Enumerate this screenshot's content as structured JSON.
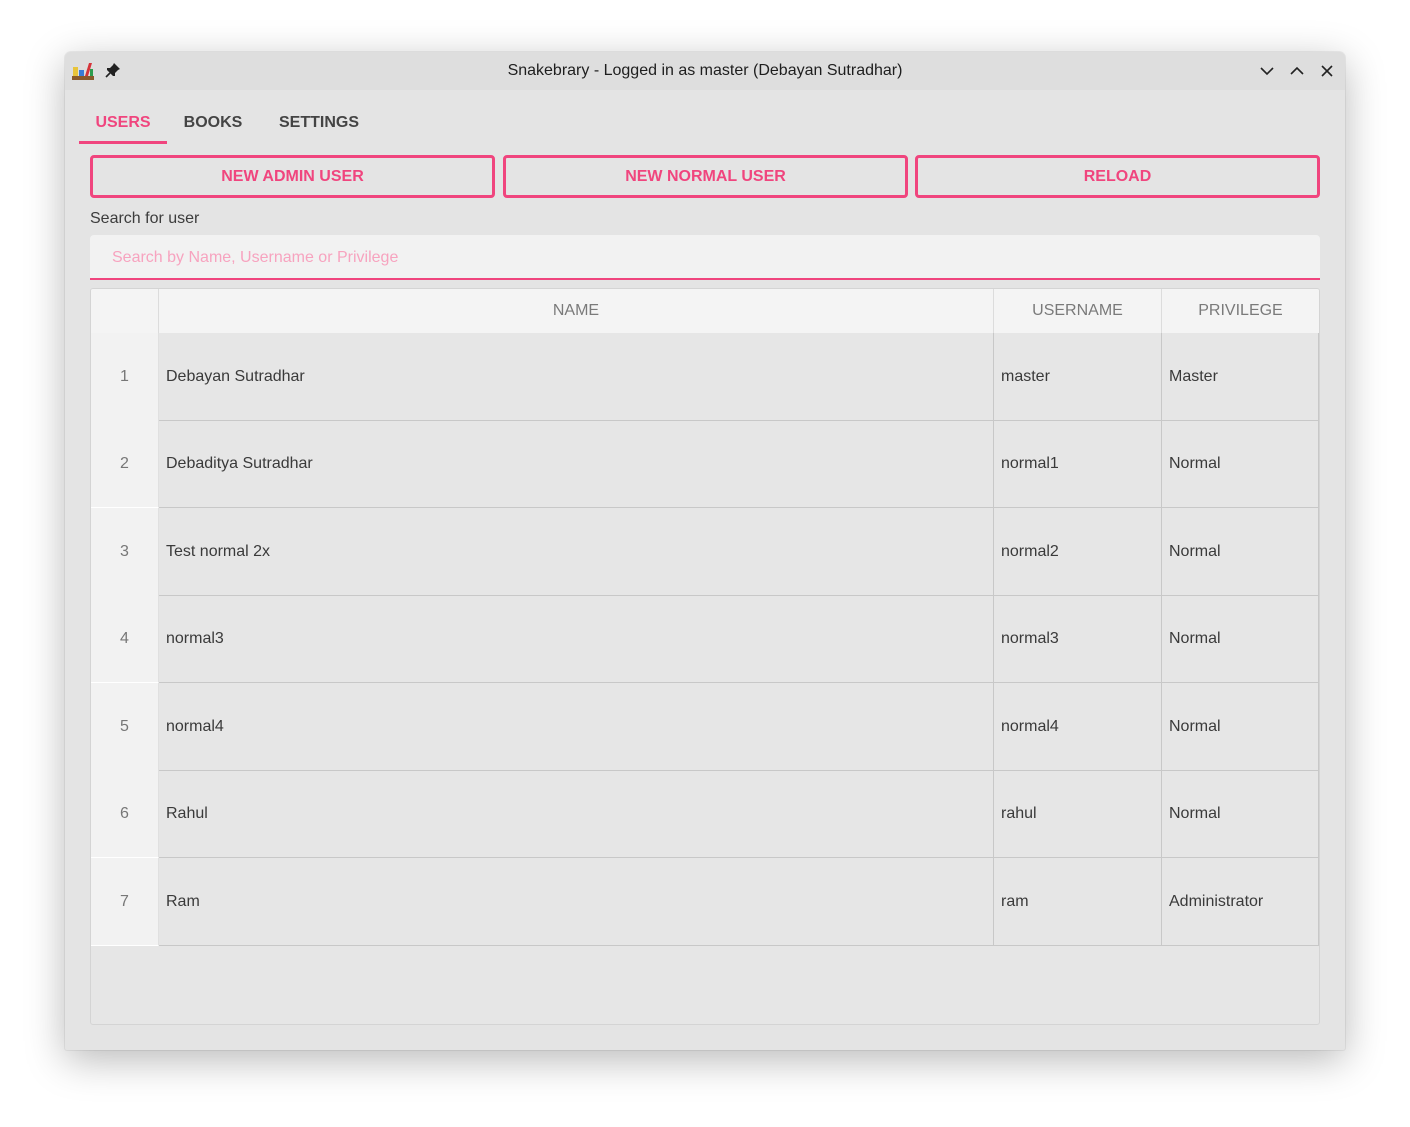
{
  "window": {
    "title": "Snakebrary - Logged in as master (Debayan Sutradhar)"
  },
  "tabs": [
    {
      "label": "USERS",
      "active": true
    },
    {
      "label": "BOOKS",
      "active": false
    },
    {
      "label": "SETTINGS",
      "active": false
    }
  ],
  "actions": {
    "new_admin": "NEW ADMIN USER",
    "new_normal": "NEW NORMAL USER",
    "reload": "RELOAD"
  },
  "search": {
    "label": "Search for user",
    "placeholder": "Search by Name, Username or Privilege",
    "value": ""
  },
  "table": {
    "columns": [
      "NAME",
      "USERNAME",
      "PRIVILEGE"
    ],
    "rows": [
      {
        "index": "1",
        "name": "Debayan Sutradhar",
        "username": "master",
        "privilege": "Master"
      },
      {
        "index": "2",
        "name": "Debaditya Sutradhar",
        "username": "normal1",
        "privilege": "Normal"
      },
      {
        "index": "3",
        "name": "Test normal 2x",
        "username": "normal2",
        "privilege": "Normal"
      },
      {
        "index": "4",
        "name": "normal3",
        "username": "normal3",
        "privilege": "Normal"
      },
      {
        "index": "5",
        "name": "normal4",
        "username": "normal4",
        "privilege": "Normal"
      },
      {
        "index": "6",
        "name": "Rahul",
        "username": "rahul",
        "privilege": "Normal"
      },
      {
        "index": "7",
        "name": "Ram",
        "username": "ram",
        "privilege": "Administrator"
      }
    ]
  },
  "colors": {
    "accent": "#f0457e",
    "background": "#e4e4e4"
  },
  "icons": {
    "app": "snakebrary-books-icon",
    "pin": "pin-icon",
    "minimize": "chevron-down-icon",
    "maximize": "chevron-up-icon",
    "close": "close-icon"
  }
}
